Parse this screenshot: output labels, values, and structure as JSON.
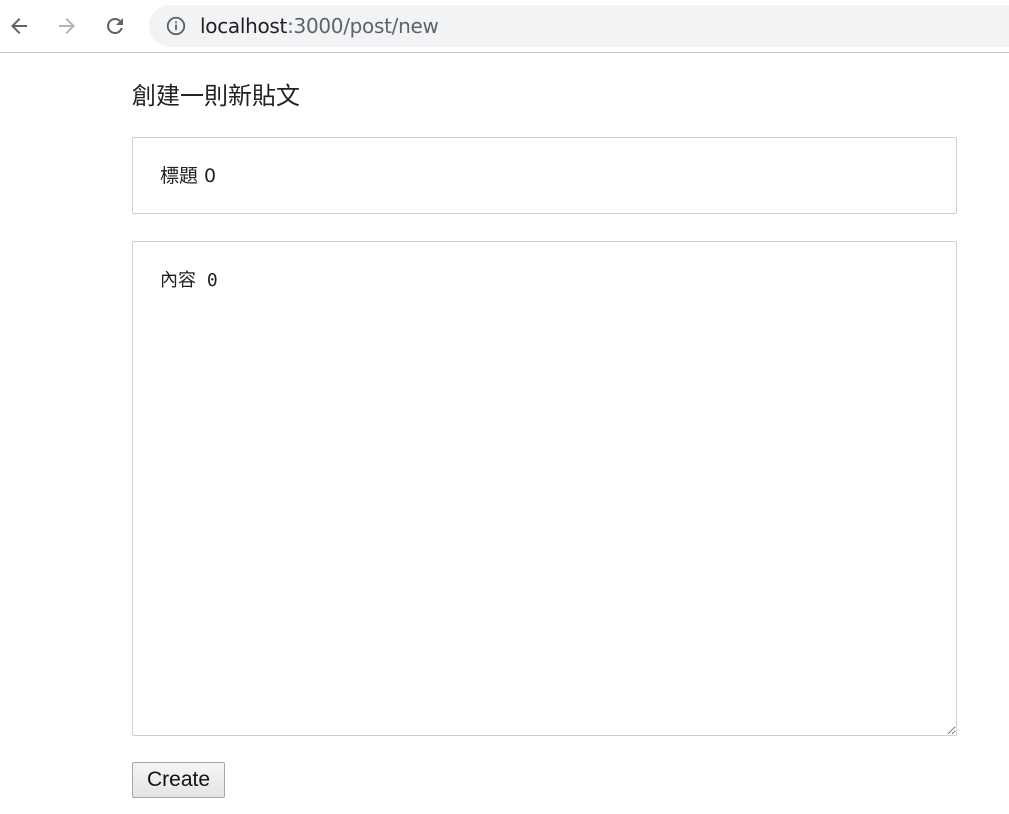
{
  "browser": {
    "url_host": "localhost",
    "url_path": ":3000/post/new"
  },
  "page": {
    "heading": "創建一則新貼文",
    "title_placeholder": "標題 0",
    "content_placeholder": "內容 0",
    "create_label": "Create"
  }
}
